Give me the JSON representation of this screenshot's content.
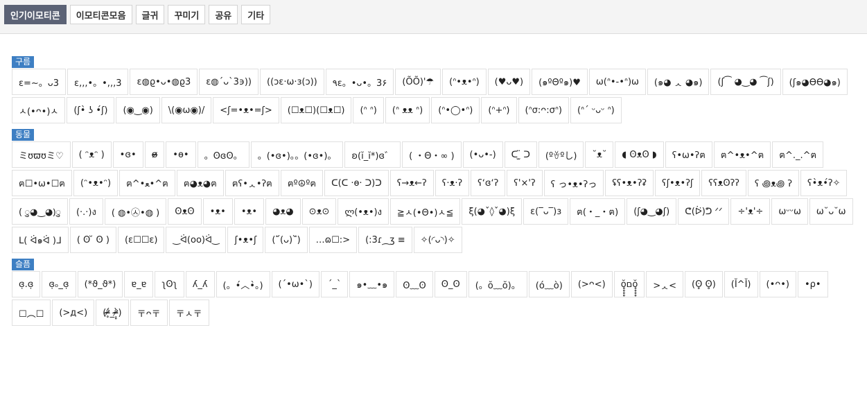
{
  "tabs": [
    "인기이모티콘",
    "이모티콘모음",
    "글귀",
    "꾸미기",
    "공유",
    "기타"
  ],
  "active_tab": 0,
  "sections": [
    {
      "label": "구름",
      "items": [
        "ε=~。ᴗ3",
        "ε,,,•。•,,,3",
        "ε◍ϱ•ᴗ•◍ϱ3",
        "ε◍´ᴗ`3϶))",
        "((ↄε·ω·ɜ(ↄ))",
        "٩ε。•ᴗ•。3۶",
        "(ÕÕ)'☂",
        "(ᐢ•ᴥ•ᐢ)",
        "(♥ᴗ♥)",
        "(๑ºΘº๑)♥",
        "ω(ᐢ•-•ᐢ)ω",
        "(๑◕ ᆺ ◕๑)",
        "(ʃ⁀ ◕‿◕ ⁀ʃ)",
        "(ʃ๑◕ϴϴ◕๑)",
        "ㅅ(•ᴖ•)ㅅ",
        "(ʃ•̀ ʖ •́ʃ)",
        "(◉‿◉)",
        "\\(◉ω◉)/",
        "<ʃ=•ᴥ•=ʃ>",
        "(☐ᴥ☐)(☐ᴥ☐)",
        "(ᐢ ᐢ)",
        "(ᐢ ᴥᴥ ᐢ)",
        "(ᐢ•◯•ᐢ)",
        "(ᐢ+ᐢ)",
        "(ᐢσ:ᴖ:σᐢ)",
        "(ᐢ´ ᵕᴗᵕ ᐢ)"
      ]
    },
    {
      "label": "동물",
      "items": [
        "ミʊϖʊミ♡",
        "( ᵔᴥᵔ )",
        "•ɞ•",
        "ɞ̴̶̷",
        "•ɵ•",
        "。ʘɞʘ。",
        "。(•ɞ•)。。(•ɞ•)。",
        "ʚ(ĭ_ĭ*)ɞ゛",
        "( ・Θ・∞ )",
        "(•ᴗ•-)",
        "ᑕ ̫̈ ᑐ",
        "(ºꈊºし)",
        "˘ᴥ˘",
        "◖ ʘᴥʘ ◗",
        "ʕ•ω•ʔฅ",
        "ฅ^•ᴥ•^ฅ",
        "ฅ^._.^ฅ",
        "ฅ☐•ω•☐ฅ",
        "(ᵔ•ᴥ•ᵔ)",
        "ฅ^•ﻌ•^ฅ",
        "ฅ◕ᴥ◕ฅ",
        "ฅʕ•ᆺ•ʔฅ",
        "ฅº☮ºฅ",
        "ᑕ(ᑕ ·ɵ· ᑐ)ᑐ",
        "ʕ→ᴥ←ʔ",
        "ʕ·ᴥ·ʔ",
        "ʕʻɞʻʔ",
        "ʕ'×'ʔ",
        "ʕ っ•ᴥ•ʔっ",
        "ʢʕ•ᴥ•ʔʡ",
        "ʕʃ•ᴥ•ʔʃ",
        "ʕʕᴥʘʔʔ",
        "ʕ ꩜ᴥ꩜ ʔ",
        "ʕ•̀ᴥ•́ʔ✧",
        "( ु◕‿◕)ु",
        "(·.·)ง",
        "( ◍•㉦•◍ )",
        "ʘᴥʘ",
        "•ᴥ•",
        "•ᴥ•",
        "◕ᴥ◕",
        "⊙ᴥ⊙",
        "ლ(•ᴥ•)ง",
        "≧ㅅ(•Θ•)ㅅ≦",
        "ξ(◕ˇ◊ˇ◕)ξ",
        "ε(‾ᴗ‾)ɜ",
        "ฅ(・_・ฅ)",
        "(ʃ◕‿◕ʃ)",
        "ᕦ(ᐖ)ᕤ ᐟᐟ",
        "÷'ᴥ'÷",
        "ωᵕᵕω",
        "ω˘ᴗ˘ω",
        "ᒪ( ᐛ๑ᐛ )ᒧ",
        "( ʘ ̆ ʘ )",
        "(ε☐☐ε)",
        "‿ᐛ(oo)ᐛ‿",
        "ʃ•ᴥ•ʃ",
        "(˘᷄(ᴗ)˘᷅)",
        "…ɷ☐:>",
        "(:3ɾ⁔ʒ ≡",
        "✧(◜ᴗ◝)✧"
      ]
    },
    {
      "label": "슬픔",
      "items": [
        "ɞ̣.ɞ̣",
        "ɞ̣ₒ_ɞ̣",
        "(*ϑ_ϑ*)",
        "ɐ_ɐ",
        "ʅʘʅ",
        "ʎ_ʎ",
        "(。•́︿•̀。)",
        "(´•ω•`)",
        "ˊ_ˋ",
        "๑•﹏•๑",
        "ʘ﹏ʘ",
        "ʘ_ʘ",
        "(。ŏ﹏ŏ)。",
        "(ó﹏ò)",
        "(>ᴖ<)",
        "ŏ̥̥̥̥םŏ̥̥̥̥",
        ">ᆺ<",
        "(ʘ̥ ʘ̥)",
        "(Ĭ^Ĭ)",
        "(•ᴖ•)",
        "•ρ•",
        "☐︵☐",
        "(>д<)",
        "(ᵒ̴̶̷̥́_ᵒ̴̶̷̣̥̀)",
        "〒ᴖ〒",
        "〒ㅅ〒"
      ]
    }
  ]
}
